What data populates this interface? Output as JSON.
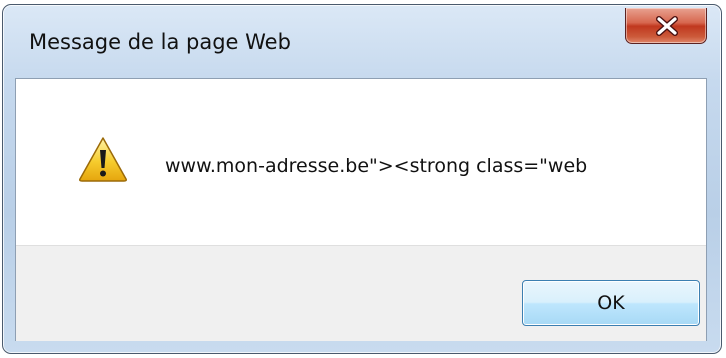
{
  "window": {
    "title": "Message de la page Web",
    "close_icon": "close-icon"
  },
  "dialog": {
    "icon": "warning-icon",
    "message": "www.mon-adresse.be\"><strong class=\"web",
    "ok_label": "OK"
  },
  "colors": {
    "frame": "#c6d9ee",
    "close_button": "#c7432a",
    "footer": "#f0f0f0",
    "ok_button_border": "#3c7fb1"
  }
}
